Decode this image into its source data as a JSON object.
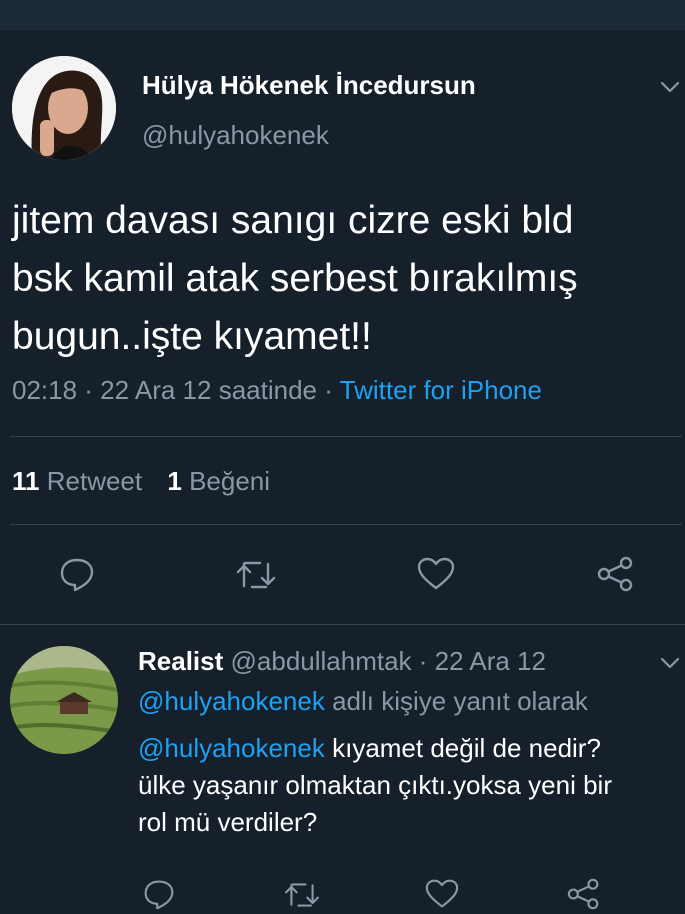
{
  "tweet": {
    "display_name": "Hülya Hökenek İncedursun",
    "handle": "@hulyahokenek",
    "text_lines": [
      "jitem davası sanıgı cizre eski bld",
      "bsk kamil atak serbest bırakılmış",
      "bugun..işte kıyamet!!"
    ],
    "time": "02:18 · 22 Ara 12 saatinde ·",
    "source": "Twitter for iPhone",
    "retweet_count": "11",
    "retweet_label": "Retweet",
    "like_count": "1",
    "like_label": "Beğeni"
  },
  "reply": {
    "display_name": "Realist",
    "meta": "@abdullahmtak · 22 Ara 12",
    "replying_handle": "@hulyahokenek",
    "replying_suffix": "adlı kişiye yanıt olarak",
    "mention": "@hulyahokenek",
    "text_line1_rest": "kıyamet değil de nedir?",
    "text_line2": "ülke yaşanır olmaktan çıktı.yoksa yeni bir",
    "text_line3": "rol mü verdiler?"
  },
  "icons": {
    "reply": "reply-icon",
    "retweet": "retweet-icon",
    "like": "heart-icon",
    "share": "share-icon",
    "menu": "chevron-down-icon"
  },
  "colors": {
    "background": "#15202b",
    "accent": "#1da1f2",
    "muted": "#8899a6",
    "divider": "#38444d"
  }
}
